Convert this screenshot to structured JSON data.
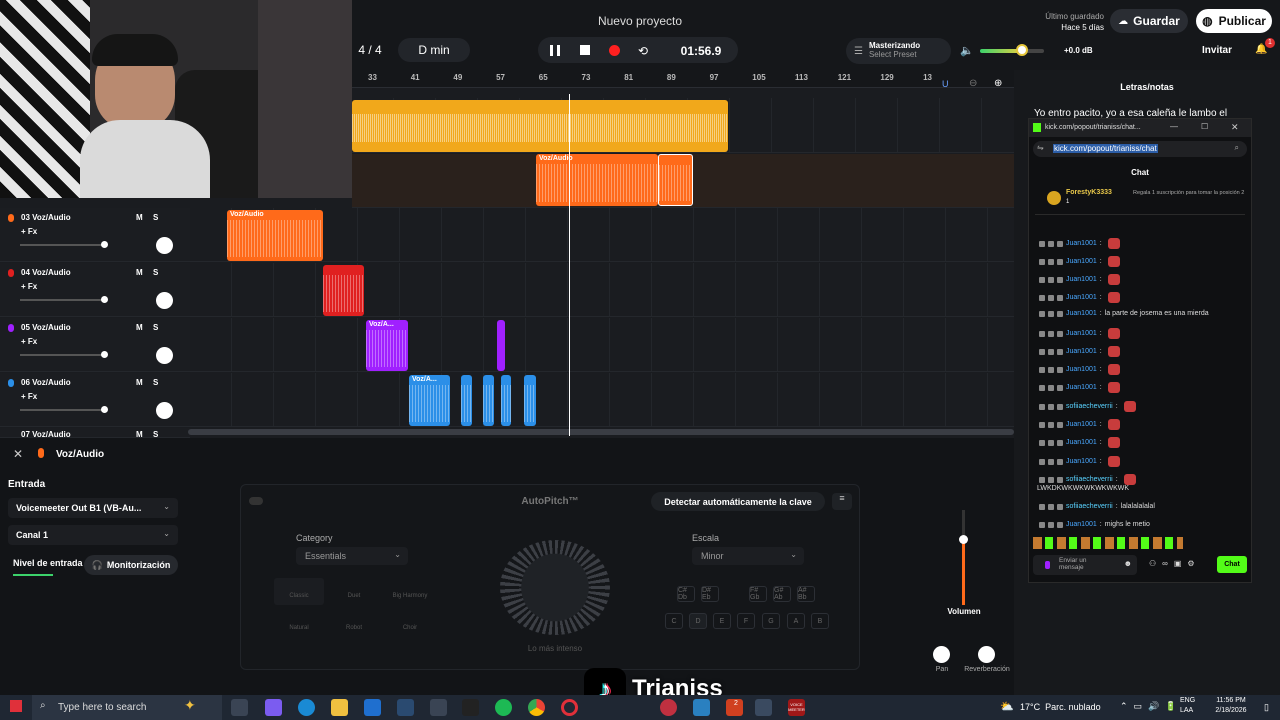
{
  "topbar": {
    "project_title": "Nuevo proyecto",
    "time_signature": "4 / 4",
    "key": "D min",
    "time": "01:56.9",
    "mastering_label": "Masterizando",
    "mastering_preset": "Select Preset",
    "volume_db": "+0.0 dB",
    "saved_label": "Último guardado",
    "saved_when": "Hace 5 días",
    "save_button": "Guardar",
    "publish_button": "Publicar",
    "invite_button": "Invitar",
    "notif_count": "1"
  },
  "ruler": [
    "33",
    "41",
    "49",
    "57",
    "65",
    "73",
    "81",
    "89",
    "97",
    "105",
    "113",
    "121",
    "129",
    "13"
  ],
  "tracks": [
    {
      "name": "03 Voz/Audio",
      "fx": "+ Fx",
      "m": "M",
      "s": "S",
      "color": "#ff6a1a"
    },
    {
      "name": "04 Voz/Audio",
      "fx": "+ Fx",
      "m": "M",
      "s": "S",
      "color": "#e02020"
    },
    {
      "name": "05 Voz/Audio",
      "fx": "+ Fx",
      "m": "M",
      "s": "S",
      "color": "#a020ff"
    },
    {
      "name": "06 Voz/Audio",
      "fx": "+ Fx",
      "m": "M",
      "s": "S",
      "color": "#2b8fe8"
    },
    {
      "name": "07 Voz/Audio",
      "m": "M",
      "s": "S"
    }
  ],
  "clips": {
    "orange_row2a": "Voz/Audio",
    "orange_row3": "Voz/Audio",
    "purple_row5": "Voz/A...",
    "blue_row6": "Voz/A..."
  },
  "panel": {
    "track_title": "Voz/Audio",
    "input_label": "Entrada",
    "input_device": "Voicemeeter Out B1 (VB-Au...",
    "channel": "Canal 1",
    "input_level_label": "Nivel de entrada",
    "monitor_button": "Monitorización",
    "plugin_title": "AutoPitch™",
    "detect_key_button": "Detectar automáticamente la clave",
    "category_label": "Category",
    "category_value": "Essentials",
    "scale_label": "Escala",
    "scale_value": "Minor",
    "presets": [
      "Classic",
      "Duet",
      "Big Harmony",
      "Natural",
      "Robot",
      "Choir"
    ],
    "knob_caption": "Lo más intenso",
    "sharp_keys": [
      "C#\nDb",
      "D#\nEb",
      "F#\nGb",
      "G#\nAb",
      "A#\nBb"
    ],
    "natural_keys": [
      "C",
      "D",
      "E",
      "F",
      "G",
      "A",
      "B"
    ],
    "volume_label": "Volumen",
    "pan_label": "Pan",
    "reverb_label": "Reverberación"
  },
  "right": {
    "lyrics_title": "Letras/notas",
    "lyrics_line": "Yo entro pacito, yo a esa caleña le lambo el",
    "window_title": "kick.com/popout/trianiss/chat...",
    "url": "kick.com/popout/trianiss/chat",
    "chat_title": "Chat",
    "top_gifter": "ForestyK3333",
    "top_gifter_count": "1",
    "gift_prompt": "Regala 1 suscripción para tomar la posición 2",
    "messages": [
      {
        "user": "Juan1001",
        "text": ""
      },
      {
        "user": "Juan1001",
        "text": ""
      },
      {
        "user": "Juan1001",
        "text": ""
      },
      {
        "user": "Juan1001",
        "text": ""
      },
      {
        "user": "Juan1001",
        "text": "la parte de josema es una mierda"
      },
      {
        "user": "Juan1001",
        "text": ""
      },
      {
        "user": "Juan1001",
        "text": ""
      },
      {
        "user": "Juan1001",
        "text": ""
      },
      {
        "user": "Juan1001",
        "text": ""
      },
      {
        "user": "sofiiaecheverrii",
        "text": ""
      },
      {
        "user": "Juan1001",
        "text": ""
      },
      {
        "user": "Juan1001",
        "text": ""
      },
      {
        "user": "Juan1001",
        "text": ""
      },
      {
        "user": "sofiiaecheverrii",
        "text": ""
      },
      {
        "user": "",
        "text": "LWKDKWKWKWKWKWKWK"
      },
      {
        "user": "sofiiaecheverrii",
        "text": "lalalalalalal"
      },
      {
        "user": "Juan1001",
        "text": "mighs le metio"
      }
    ],
    "send_placeholder": "Enviar un mensaje",
    "send_button": "Chat"
  },
  "overlay": {
    "watermark": "Trianiss"
  },
  "taskbar": {
    "search_placeholder": "Type here to search",
    "weather": "17°C  Parc. nublado",
    "lang": "ENG\nLAA",
    "time": "11:56 PM",
    "date": "2/18/2026",
    "voicemeeter": "VOICE\nMEETER",
    "badge2": "2"
  }
}
